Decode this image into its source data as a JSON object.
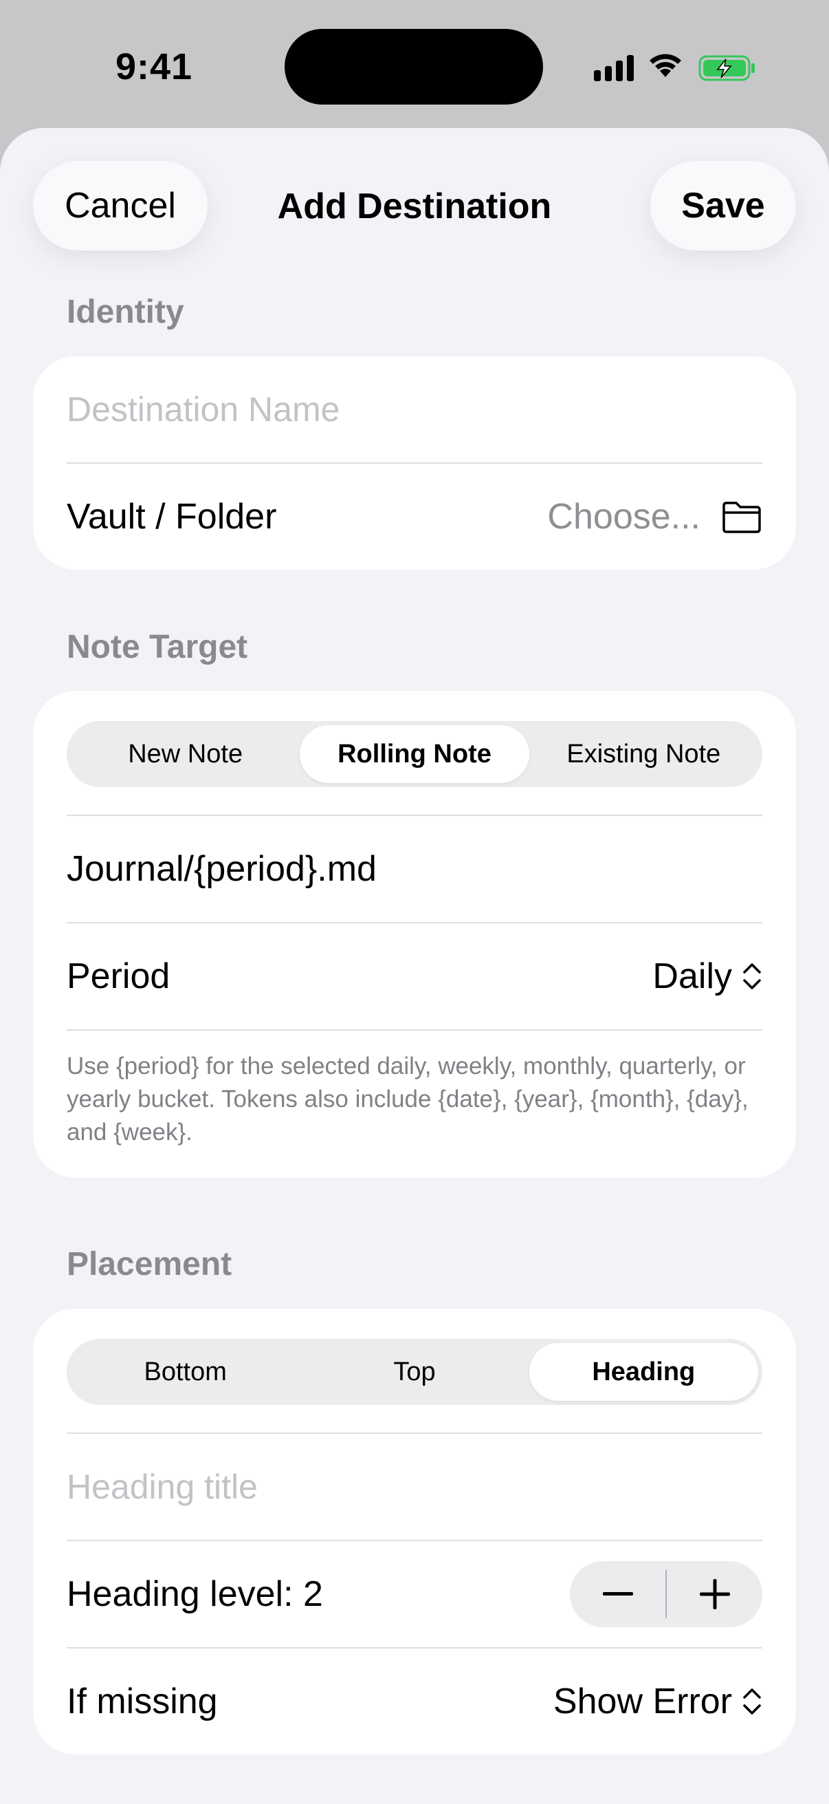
{
  "status_bar": {
    "time": "9:41"
  },
  "nav": {
    "cancel_label": "Cancel",
    "title": "Add Destination",
    "save_label": "Save"
  },
  "identity": {
    "header": "Identity",
    "name_placeholder": "Destination Name",
    "folder_label": "Vault / Folder",
    "folder_value": "Choose..."
  },
  "note_target": {
    "header": "Note Target",
    "segments": [
      "New Note",
      "Rolling Note",
      "Existing Note"
    ],
    "selected_segment": "Rolling Note",
    "path_value": "Journal/{period}.md",
    "period_label": "Period",
    "period_value": "Daily",
    "footnote": "Use {period} for the selected daily, weekly, monthly, quarterly, or yearly bucket. Tokens also include {date}, {year}, {month}, {day}, and {week}."
  },
  "placement": {
    "header": "Placement",
    "segments": [
      "Bottom",
      "Top",
      "Heading"
    ],
    "selected_segment": "Heading",
    "heading_placeholder": "Heading title",
    "heading_level_label": "Heading level: 2",
    "if_missing_label": "If missing",
    "if_missing_value": "Show Error"
  },
  "icons": {
    "signal": "cellular-signal-icon",
    "wifi": "wifi-icon",
    "battery": "battery-charging-icon",
    "folder": "folder-icon",
    "updown": "chevron-up-down-icon",
    "minus": "minus-icon",
    "plus": "plus-icon"
  },
  "colors": {
    "battery_fill": "#34c759",
    "accent_text": "#000000",
    "secondary_text": "#8e8e93"
  }
}
